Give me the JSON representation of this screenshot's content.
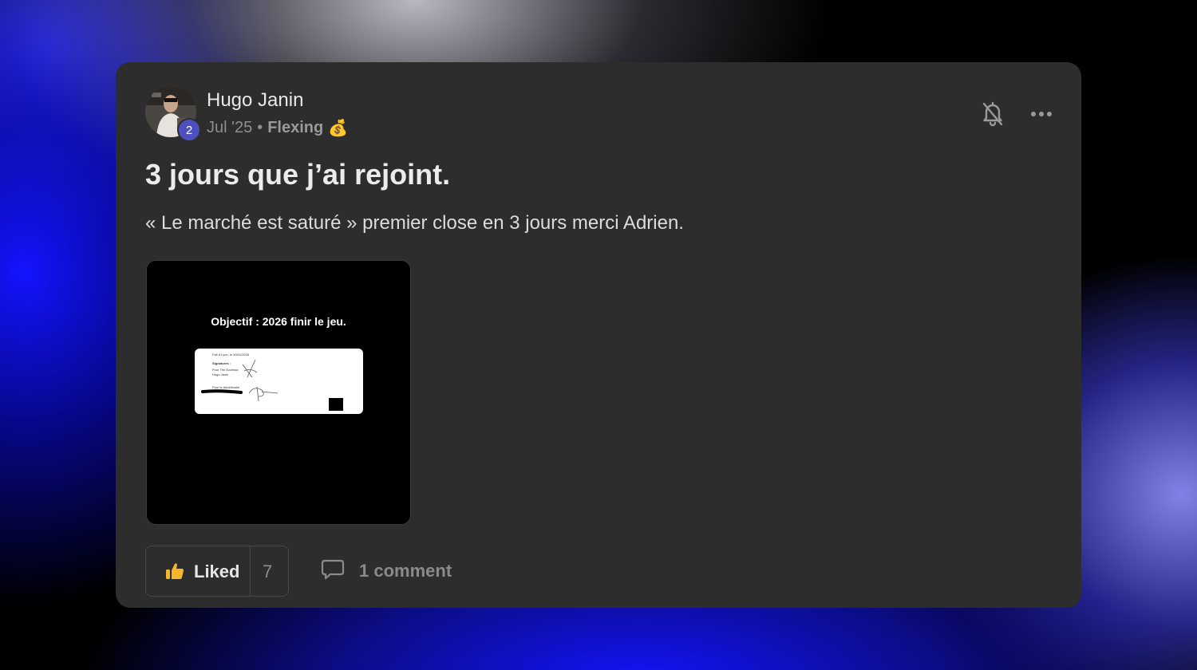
{
  "post": {
    "author": "Hugo Janin",
    "level": "2",
    "date": "Jul '25",
    "separator": "•",
    "category": "Flexing",
    "category_emoji": "💰",
    "title": "3 jours que j’ai rejoint.",
    "body": "« Le marché est saturé » premier close en 3 jours merci Adrien.",
    "attachment": {
      "caption": "Objectif : 2026 finir le jeu.",
      "doc_lines": [
        "Fait à Lyon, le 00/01/2026",
        "Signatures :",
        "Pour The Ecclesia",
        "Hugo Janin",
        "Pour le bénéficiaire"
      ]
    }
  },
  "actions": {
    "like_label": "Liked",
    "like_count": "7",
    "comment_label": "1 comment"
  },
  "icons": [
    "bell-off-icon",
    "more-icon",
    "thumbs-up-icon",
    "comment-icon"
  ],
  "colors": {
    "card": "#2d2d2d",
    "badge": "#4d4fbc",
    "like_accent": "#f2b62f"
  }
}
